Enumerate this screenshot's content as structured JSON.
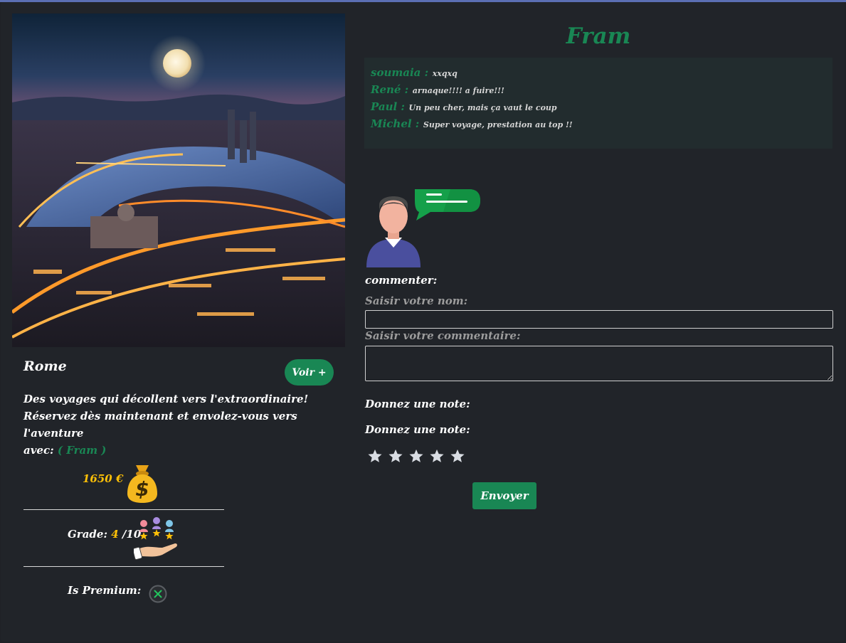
{
  "destination": {
    "city": "Rome",
    "voir_label": "Voir +",
    "description_line1": "Des voyages qui décollent vers l'extraordinaire!",
    "description_line2": "Réservez dès maintenant et envolez-vous vers l'aventure",
    "description_avec": "avec:",
    "agency_paren": "( Fram )",
    "price": "1650 €",
    "grade_label": "Grade:",
    "grade_value": "4",
    "grade_max": "/10",
    "premium_label": "Is Premium:",
    "premium_icon": "x-circle-icon",
    "photo_icon": "city-night-photo"
  },
  "agency": {
    "title": "Fram"
  },
  "comments": [
    {
      "author": "soumaia :",
      "text": "xxqxq"
    },
    {
      "author": "René :",
      "text": "arnaque!!!! a fuire!!!"
    },
    {
      "author": "Paul :",
      "text": "Un peu cher, mais ça vaut le coup"
    },
    {
      "author": "Michel :",
      "text": "Super voyage, prestation au top !!"
    }
  ],
  "form": {
    "commenter_label": "commenter:",
    "name_label": "Saisir votre nom:",
    "name_value": "",
    "comment_label": "Saisir votre commentaire:",
    "comment_value": "",
    "note_label_1": "Donnez une note:",
    "note_label_2": "Donnez une note:",
    "stars_total": 5,
    "stars_selected": 0,
    "send_label": "Envoyer"
  },
  "colors": {
    "accent_green": "#198754",
    "price_yellow": "#ffc107",
    "background": "#212429",
    "comment_box": "#222c2e"
  }
}
